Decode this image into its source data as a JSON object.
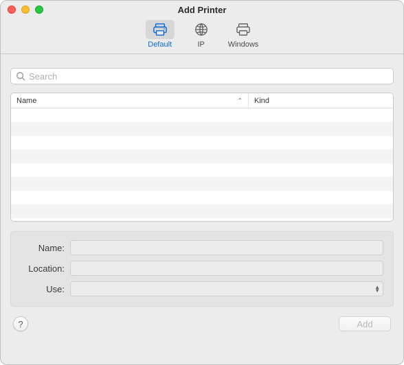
{
  "window": {
    "title": "Add Printer"
  },
  "toolbar": {
    "items": [
      {
        "label": "Default",
        "selected": true
      },
      {
        "label": "IP",
        "selected": false
      },
      {
        "label": "Windows",
        "selected": false
      }
    ]
  },
  "search": {
    "placeholder": "Search",
    "value": ""
  },
  "list": {
    "columns": {
      "name": "Name",
      "kind": "Kind"
    },
    "sort_column": "name",
    "sort_dir": "asc",
    "rows": []
  },
  "form": {
    "name_label": "Name:",
    "location_label": "Location:",
    "use_label": "Use:",
    "name_value": "",
    "location_value": "",
    "use_value": ""
  },
  "footer": {
    "help_label": "?",
    "add_label": "Add",
    "add_enabled": false
  }
}
